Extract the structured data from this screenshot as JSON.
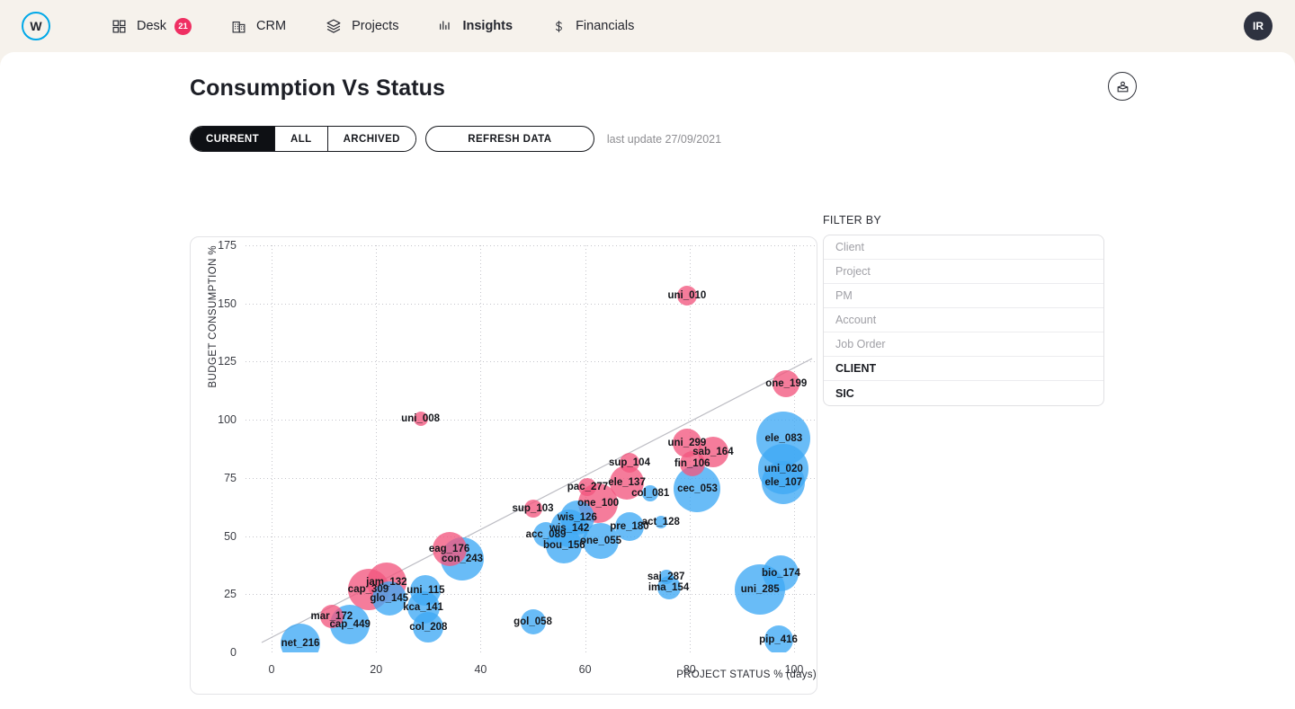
{
  "nav": {
    "logo_letter": "W",
    "items": [
      {
        "label": "Desk",
        "icon": "grid-icon",
        "badge": "21",
        "active": false
      },
      {
        "label": "CRM",
        "icon": "building-icon",
        "badge": null,
        "active": false
      },
      {
        "label": "Projects",
        "icon": "layers-icon",
        "badge": null,
        "active": false
      },
      {
        "label": "Insights",
        "icon": "bar-chart-icon",
        "badge": null,
        "active": true
      },
      {
        "label": "Financials",
        "icon": "dollar-icon",
        "badge": null,
        "active": false
      }
    ],
    "avatar_initials": "IR"
  },
  "header": {
    "title": "Consumption Vs Status",
    "portfolio_icon": "person-in-box-icon"
  },
  "toolbar": {
    "segments": [
      {
        "label": "CURRENT",
        "active": true
      },
      {
        "label": "ALL",
        "active": false
      },
      {
        "label": "ARCHIVED",
        "active": false
      }
    ],
    "refresh_label": "REFRESH DATA",
    "last_update": "last update 27/09/2021"
  },
  "filter": {
    "title": "FILTER BY",
    "rows": [
      {
        "label": "Client",
        "selected": false
      },
      {
        "label": "Project",
        "selected": false
      },
      {
        "label": "PM",
        "selected": false
      },
      {
        "label": "Account",
        "selected": false
      },
      {
        "label": "Job Order",
        "selected": false
      },
      {
        "label": "CLIENT",
        "selected": true
      },
      {
        "label": "SIC",
        "selected": true
      }
    ]
  },
  "colors": {
    "accent_blue": "#00a8e8",
    "badge_red": "#ef2f62",
    "bubble_pink": "#f2577f",
    "bubble_blue": "#3fa9f5",
    "page_bg": "#f6f2ec",
    "dark": "#2e3240"
  },
  "chart_data": {
    "type": "scatter",
    "title": "Consumption Vs Status",
    "xlabel": "PROJECT STATUS % (days)",
    "ylabel": "BUDGET CONSUMPTION %",
    "xlim": [
      -5,
      105
    ],
    "ylim": [
      0,
      175
    ],
    "xticks": [
      0,
      20,
      40,
      60,
      80,
      100
    ],
    "yticks": [
      0,
      25,
      50,
      75,
      100,
      125,
      150,
      175
    ],
    "grid": true,
    "legend": "none",
    "bubble_size_meaning": "budget value",
    "points": [
      {
        "label": "uni_010",
        "x": 79.5,
        "y": 153.5,
        "r": 11,
        "color": "#f2577f"
      },
      {
        "label": "one_199",
        "x": 98.5,
        "y": 115.5,
        "r": 15,
        "color": "#f2577f"
      },
      {
        "label": "uni_008",
        "x": 28.5,
        "y": 100.5,
        "r": 8,
        "color": "#f2577f"
      },
      {
        "label": "ele_083",
        "x": 98.0,
        "y": 92.0,
        "r": 30,
        "color": "#3fa9f5"
      },
      {
        "label": "uni_299",
        "x": 79.5,
        "y": 90.0,
        "r": 16,
        "color": "#f2577f"
      },
      {
        "label": "sab_164",
        "x": 84.5,
        "y": 86.0,
        "r": 17,
        "color": "#f2577f"
      },
      {
        "label": "sup_104",
        "x": 68.5,
        "y": 81.5,
        "r": 11,
        "color": "#f2577f"
      },
      {
        "label": "fin_106",
        "x": 80.5,
        "y": 81.0,
        "r": 14,
        "color": "#f2577f"
      },
      {
        "label": "uni_020",
        "x": 98.0,
        "y": 79.0,
        "r": 28,
        "color": "#3fa9f5"
      },
      {
        "label": "ele_107",
        "x": 98.0,
        "y": 73.0,
        "r": 24,
        "color": "#3fa9f5"
      },
      {
        "label": "cec_053",
        "x": 81.5,
        "y": 70.5,
        "r": 26,
        "color": "#3fa9f5"
      },
      {
        "label": "ele_137",
        "x": 68.0,
        "y": 73.0,
        "r": 19,
        "color": "#f2577f"
      },
      {
        "label": "pac_277",
        "x": 60.5,
        "y": 71.0,
        "r": 10,
        "color": "#f2577f"
      },
      {
        "label": "col_081",
        "x": 72.5,
        "y": 68.5,
        "r": 9,
        "color": "#3fa9f5"
      },
      {
        "label": "one_100",
        "x": 62.5,
        "y": 64.0,
        "r": 22,
        "color": "#f2577f"
      },
      {
        "label": "sup_103",
        "x": 50.0,
        "y": 62.0,
        "r": 10,
        "color": "#f2577f"
      },
      {
        "label": "wis_126",
        "x": 58.5,
        "y": 58.0,
        "r": 19,
        "color": "#3fa9f5"
      },
      {
        "label": "act_128",
        "x": 74.5,
        "y": 56.0,
        "r": 7,
        "color": "#3fa9f5"
      },
      {
        "label": "wis_142",
        "x": 57.0,
        "y": 53.5,
        "r": 21,
        "color": "#3fa9f5"
      },
      {
        "label": "pre_180",
        "x": 68.5,
        "y": 54.0,
        "r": 16,
        "color": "#3fa9f5"
      },
      {
        "label": "acc_089",
        "x": 52.5,
        "y": 50.5,
        "r": 14,
        "color": "#3fa9f5"
      },
      {
        "label": "one_055",
        "x": 63.0,
        "y": 48.0,
        "r": 20,
        "color": "#3fa9f5"
      },
      {
        "label": "bou_156",
        "x": 56.0,
        "y": 46.0,
        "r": 20,
        "color": "#3fa9f5"
      },
      {
        "label": "eag_176",
        "x": 34.0,
        "y": 44.5,
        "r": 19,
        "color": "#f2577f"
      },
      {
        "label": "con_243",
        "x": 36.5,
        "y": 40.0,
        "r": 24,
        "color": "#3fa9f5"
      },
      {
        "label": "bio_174",
        "x": 97.5,
        "y": 34.0,
        "r": 20,
        "color": "#3fa9f5"
      },
      {
        "label": "saj_287",
        "x": 75.5,
        "y": 32.5,
        "r": 8,
        "color": "#3fa9f5"
      },
      {
        "label": "ima_154",
        "x": 76.0,
        "y": 28.0,
        "r": 13,
        "color": "#3fa9f5"
      },
      {
        "label": "uni_285",
        "x": 93.5,
        "y": 27.0,
        "r": 28,
        "color": "#3fa9f5"
      },
      {
        "label": "jam_132",
        "x": 22.0,
        "y": 30.0,
        "r": 22,
        "color": "#f2577f"
      },
      {
        "label": "cap_309",
        "x": 18.5,
        "y": 27.0,
        "r": 23,
        "color": "#f2577f"
      },
      {
        "label": "uni_115",
        "x": 29.5,
        "y": 26.5,
        "r": 17,
        "color": "#3fa9f5"
      },
      {
        "label": "glo_145",
        "x": 22.5,
        "y": 23.0,
        "r": 19,
        "color": "#3fa9f5"
      },
      {
        "label": "kca_141",
        "x": 29.0,
        "y": 19.5,
        "r": 18,
        "color": "#3fa9f5"
      },
      {
        "label": "mar_172",
        "x": 11.5,
        "y": 15.5,
        "r": 13,
        "color": "#f2577f"
      },
      {
        "label": "cap_449",
        "x": 15.0,
        "y": 12.0,
        "r": 22,
        "color": "#3fa9f5"
      },
      {
        "label": "col_208",
        "x": 30.0,
        "y": 11.0,
        "r": 17,
        "color": "#3fa9f5"
      },
      {
        "label": "gol_058",
        "x": 50.0,
        "y": 13.0,
        "r": 14,
        "color": "#3fa9f5"
      },
      {
        "label": "pip_416",
        "x": 97.0,
        "y": 5.5,
        "r": 16,
        "color": "#3fa9f5"
      },
      {
        "label": "net_216",
        "x": 5.5,
        "y": 4.0,
        "r": 22,
        "color": "#3fa9f5"
      }
    ]
  }
}
